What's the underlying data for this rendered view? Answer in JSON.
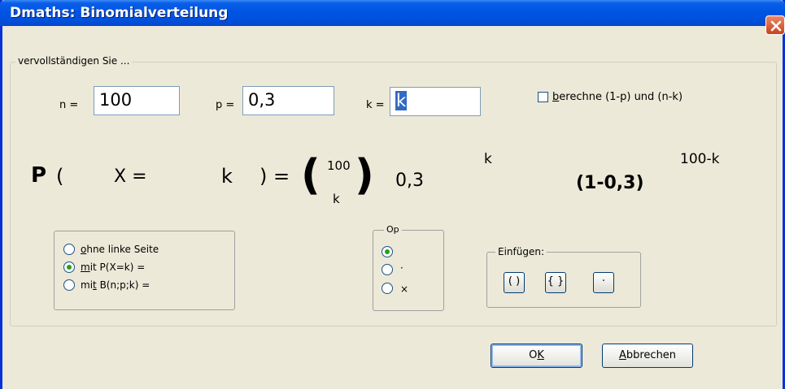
{
  "window": {
    "title": "Dmaths: Binomialverteilung"
  },
  "main_group": {
    "legend": "vervollständigen Sie ..."
  },
  "fields": {
    "n_label": "n =",
    "n_value": "100",
    "p_label": "p =",
    "p_value": "0,3",
    "k_label": "k =",
    "k_value": "k"
  },
  "checkbox": {
    "label_prefix": "b",
    "label_rest": "erechne (1-p) und (n-k)",
    "checked": false
  },
  "formula": {
    "p": "P",
    "open_paren": "(",
    "x_eq": "X =",
    "k": "k",
    "close_eq": ") =",
    "big_open": "(",
    "binom_top": "100",
    "binom_bottom": "k",
    "big_close": ")",
    "prob": "0,3",
    "exp_k": "k",
    "one_minus": "(1-0,3)",
    "exp_nk": "100-k"
  },
  "mode_options": [
    {
      "u": "o",
      "rest": "hne linke Seite",
      "selected": false
    },
    {
      "u": "m",
      "rest": "it P(X=k) =",
      "selected": true
    },
    {
      "pre": "mi",
      "u": "t",
      "rest": " B(n;p;k) =",
      "selected": false
    }
  ],
  "op_group": {
    "legend": "Op",
    "options": [
      {
        "label": "",
        "selected": true
      },
      {
        "label": "·",
        "selected": false
      },
      {
        "label": "×",
        "selected": false
      }
    ]
  },
  "insert_group": {
    "legend": "Einfügen:",
    "buttons": [
      "( )",
      "{ }",
      "·"
    ]
  },
  "buttons": {
    "ok_u": "K",
    "ok_pre": "O",
    "cancel_u": "A",
    "cancel_rest": "bbrechen"
  },
  "colors": {
    "title_blue": "#0054E3",
    "dialog_bg": "#ECE9D8",
    "radio_dot": "#21A121",
    "close_red": "#D5532F"
  }
}
